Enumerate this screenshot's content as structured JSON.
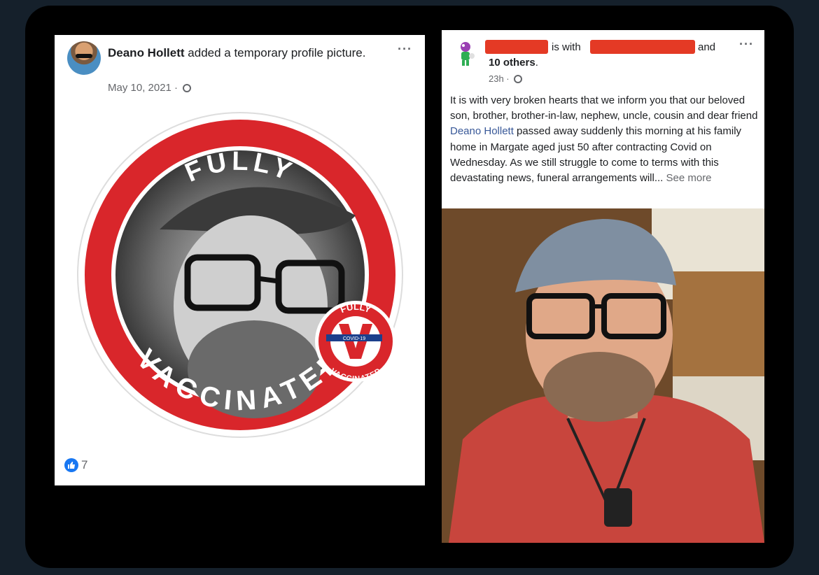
{
  "left_post": {
    "author": "Deano Hollett",
    "action": " added a temporary profile picture.",
    "date": "May 10, 2021 ·",
    "menu": "···",
    "reaction_count": "7",
    "badge": {
      "top_text": "FULLY",
      "bottom_text": "VACCINATED",
      "mini_top": "FULLY",
      "mini_bottom": "VACCINATED",
      "syringe_label": "COVID-19"
    }
  },
  "right_post": {
    "with_text": "is with",
    "and_text": "and",
    "others": "10 others",
    "time": "23h ·",
    "menu": "···",
    "body_1": "It is with very broken hearts that we inform you that our beloved son, brother, brother-in-law, nephew, uncle, cousin and dear friend ",
    "body_link": "Deano Hollett",
    "body_2": " passed away suddenly this morning at his family home in Margate aged just 50 after contracting Covid on Wednesday. As we still struggle to come to terms with this devastating news, funeral arrangements will...",
    "see_more": " See more"
  },
  "colors": {
    "badge_red": "#d9262b",
    "link_blue": "#385898",
    "like_blue": "#1877f2",
    "redaction": "#e43a25"
  }
}
